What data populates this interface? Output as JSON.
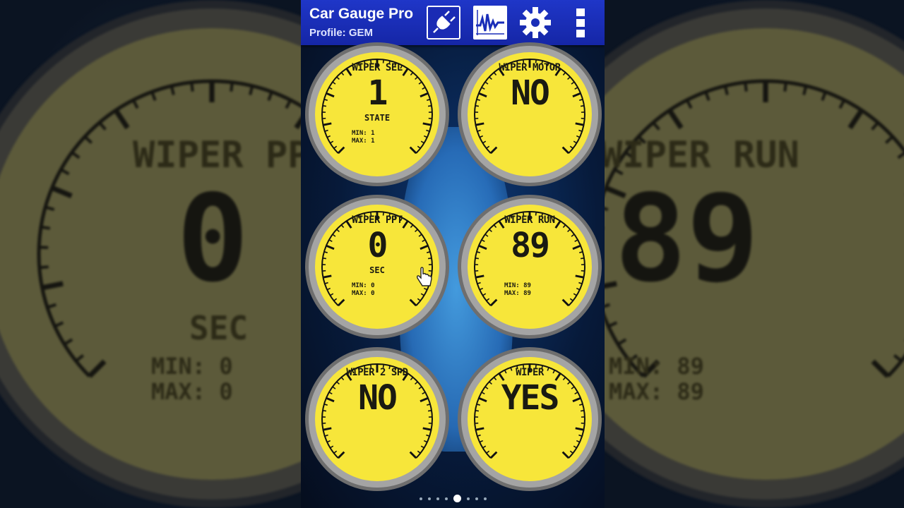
{
  "app": {
    "title": "Car Gauge Pro",
    "profile": "Profile: GEM"
  },
  "toolbar": [
    {
      "name": "connect-button",
      "icon": "plug-icon"
    },
    {
      "name": "graph-button",
      "icon": "waveform-icon"
    },
    {
      "name": "settings-button",
      "icon": "gear-icon"
    },
    {
      "name": "overflow-menu-button",
      "icon": "vertical-dots-icon"
    }
  ],
  "gauges": [
    {
      "title": "WIPER SEL",
      "value": "1",
      "unit": "STATE",
      "min": "MIN: 1",
      "max": "MAX: 1"
    },
    {
      "title": "WIPER MOTOR",
      "value": "NO",
      "unit": "",
      "min": "",
      "max": ""
    },
    {
      "title": "WIPER PPT",
      "value": "0",
      "unit": "SEC",
      "min": "MIN: 0",
      "max": "MAX: 0"
    },
    {
      "title": "WIPER RUN",
      "value": "89",
      "unit": "",
      "min": "MIN: 89",
      "max": "MAX: 89"
    },
    {
      "title": "WIPER 2 SPD",
      "value": "NO",
      "unit": "",
      "min": "",
      "max": ""
    },
    {
      "title": "WIPER",
      "value": "YES",
      "unit": "",
      "min": "",
      "max": ""
    }
  ],
  "pager": {
    "count": 8,
    "active": 4
  },
  "colors": {
    "gauge_face": "#f7e63a",
    "bezel": "#8d8d8d",
    "actionbar": "#1a2eb8"
  }
}
